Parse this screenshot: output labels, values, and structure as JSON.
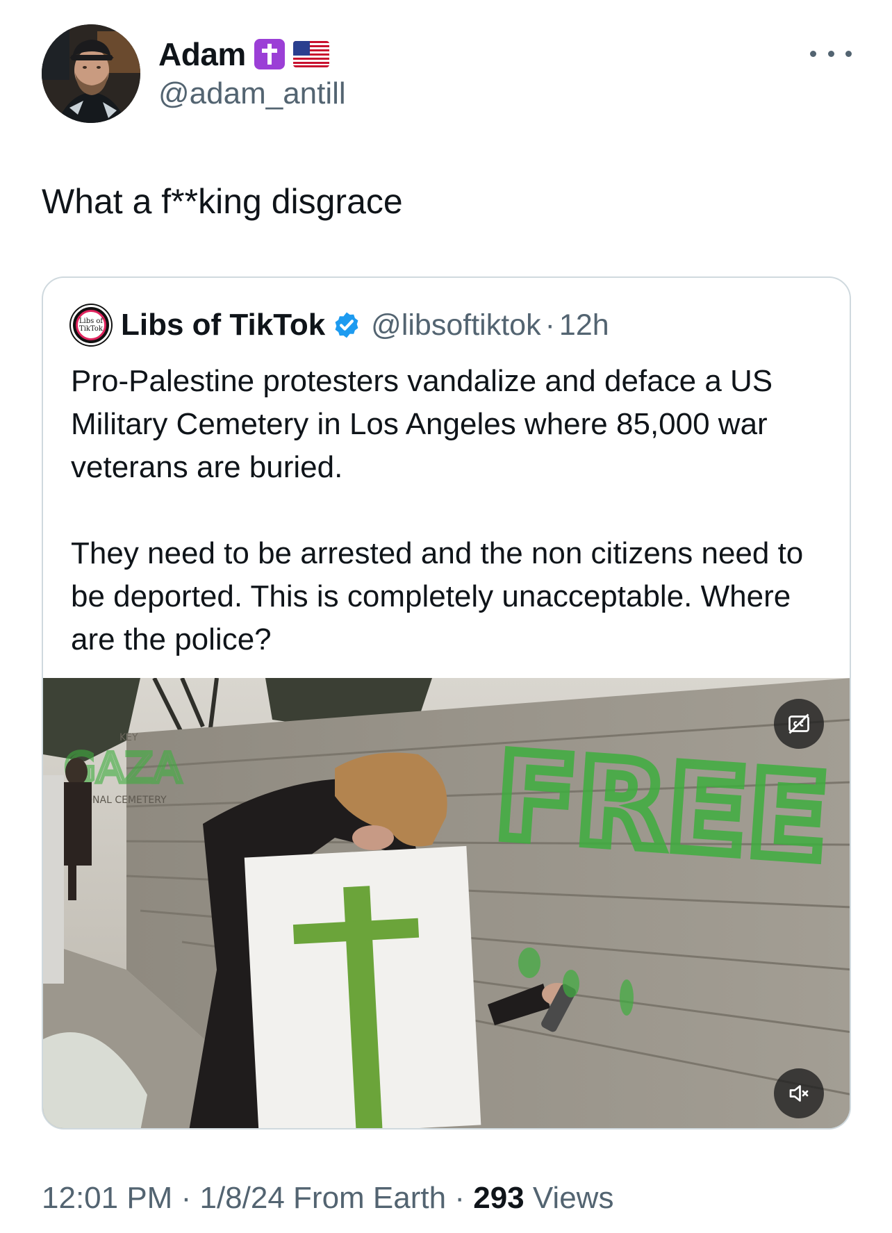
{
  "author": {
    "display_name": "Adam",
    "handle": "@adam_antill",
    "avatar": "avatar",
    "badges": [
      "latin-cross-emoji",
      "us-flag-emoji"
    ]
  },
  "menu": {
    "icon": "more-horizontal-icon"
  },
  "tweet": {
    "text": "What a f**king disgrace"
  },
  "quote": {
    "display_name": "Libs of TikTok",
    "avatar_text": "Libs of TikTok",
    "verified_icon": "verified-badge-icon",
    "handle": "@libsoftiktok",
    "separator": "·",
    "time": "12h",
    "paragraph_1": "Pro-Palestine protesters vandalize and deface a US Military Cemetery in Los Angeles where 85,000 war veterans are buried.",
    "paragraph_2": "They need to be arrested and the non citizens need to be deported. This is completely unacceptable. Where are the police?",
    "media": {
      "captions_icon": "closed-captions-off-icon",
      "mute_icon": "volume-muted-icon",
      "wall_graffiti": "FREE",
      "sign_text": "KEY",
      "sign_text_2": "ONAL CEMETERY"
    }
  },
  "footer": {
    "time": "12:01 PM",
    "sep1": "·",
    "date": "1/8/24",
    "source": "From Earth",
    "sep2": "·",
    "views_count": "293",
    "views_label": "Views"
  },
  "colors": {
    "text": "#0f1419",
    "secondary": "#536471",
    "border": "#cfd9de",
    "verified": "#1d9bf0",
    "graffiti": "#3fae3f"
  }
}
